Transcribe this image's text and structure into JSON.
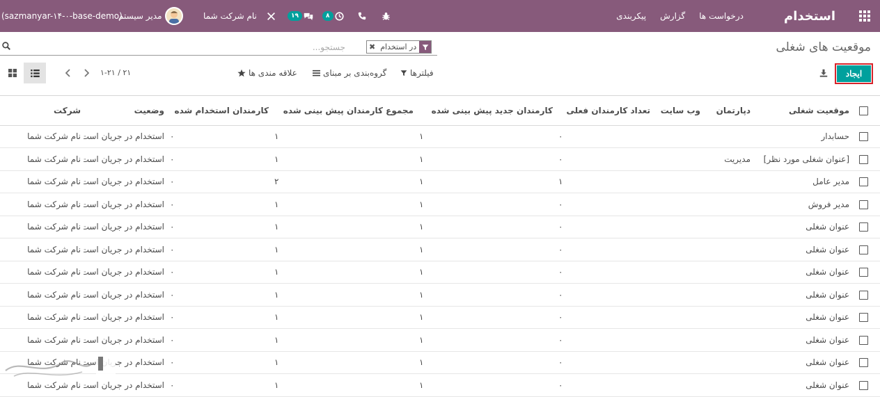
{
  "navbar": {
    "app_title": "استخدام",
    "menu": [
      "درخواست ها",
      "گزارش",
      "پیکربندی"
    ],
    "activity_badge": "۸",
    "messages_badge": "۱۹",
    "company_name": "نام شرکت شما",
    "user_name": "مدیر سیستم",
    "database": "(sazmanyar-۱۴-۰-base-demo)",
    "colors": {
      "brand": "#875a7b",
      "badge": "#00a09d"
    }
  },
  "control_panel": {
    "page_title": "موقعیت های شغلی",
    "search_placeholder": "جستجو...",
    "facet_label": "در استخدام",
    "create_label": "ایجاد",
    "filters_label": "فیلترها",
    "groupby_label": "گروه‌بندی بر مبنای",
    "favorites_label": "علاقه مندی ها",
    "pager_value": "۱-۲۱ / ۲۱"
  },
  "table": {
    "columns": [
      "موقعیت شغلی",
      "دپارتمان",
      "وب سایت",
      "تعداد کارمندان فعلی",
      "کارمندان جدید پیش بینی شده",
      "مجموع کارمندان پیش بینی شده",
      "کارمندان استخدام شده",
      "وضعیت",
      "شرکت"
    ],
    "rows": [
      [
        "حسابدار",
        "",
        "",
        "۰",
        "۱",
        "۱",
        "۰",
        "استخدام در جریان است",
        "نام شرکت شما"
      ],
      [
        "[عنوان شغلی مورد نظر]",
        "مدیریت",
        "",
        "۰",
        "۱",
        "۱",
        "۰",
        "استخدام در جریان است",
        "نام شرکت شما"
      ],
      [
        "مدیر عامل",
        "",
        "",
        "۱",
        "۱",
        "۲",
        "۰",
        "استخدام در جریان است",
        "نام شرکت شما"
      ],
      [
        "مدیر فروش",
        "",
        "",
        "۰",
        "۱",
        "۱",
        "۰",
        "استخدام در جریان است",
        "نام شرکت شما"
      ],
      [
        "عنوان شغلی",
        "",
        "",
        "۰",
        "۱",
        "۱",
        "۰",
        "استخدام در جریان است",
        "نام شرکت شما"
      ],
      [
        "عنوان شغلی",
        "",
        "",
        "۰",
        "۱",
        "۱",
        "۰",
        "استخدام در جریان است",
        "نام شرکت شما"
      ],
      [
        "عنوان شغلی",
        "",
        "",
        "۰",
        "۱",
        "۱",
        "۰",
        "استخدام در جریان است",
        "نام شرکت شما"
      ],
      [
        "عنوان شغلی",
        "",
        "",
        "۰",
        "۱",
        "۱",
        "۰",
        "استخدام در جریان است",
        "نام شرکت شما"
      ],
      [
        "عنوان شغلی",
        "",
        "",
        "۰",
        "۱",
        "۱",
        "۰",
        "استخدام در جریان است",
        "نام شرکت شما"
      ],
      [
        "عنوان شغلی",
        "",
        "",
        "۰",
        "۱",
        "۱",
        "۰",
        "استخدام در جریان است",
        "نام شرکت شما"
      ],
      [
        "عنوان شغلی",
        "",
        "",
        "۰",
        "۱",
        "۱",
        "۰",
        "استخدام در جریان است",
        "نام شرکت شما"
      ],
      [
        "عنوان شغلی",
        "",
        "",
        "۰",
        "۱",
        "۱",
        "۰",
        "استخدام در جریان است",
        "نام شرکت شما"
      ]
    ]
  }
}
